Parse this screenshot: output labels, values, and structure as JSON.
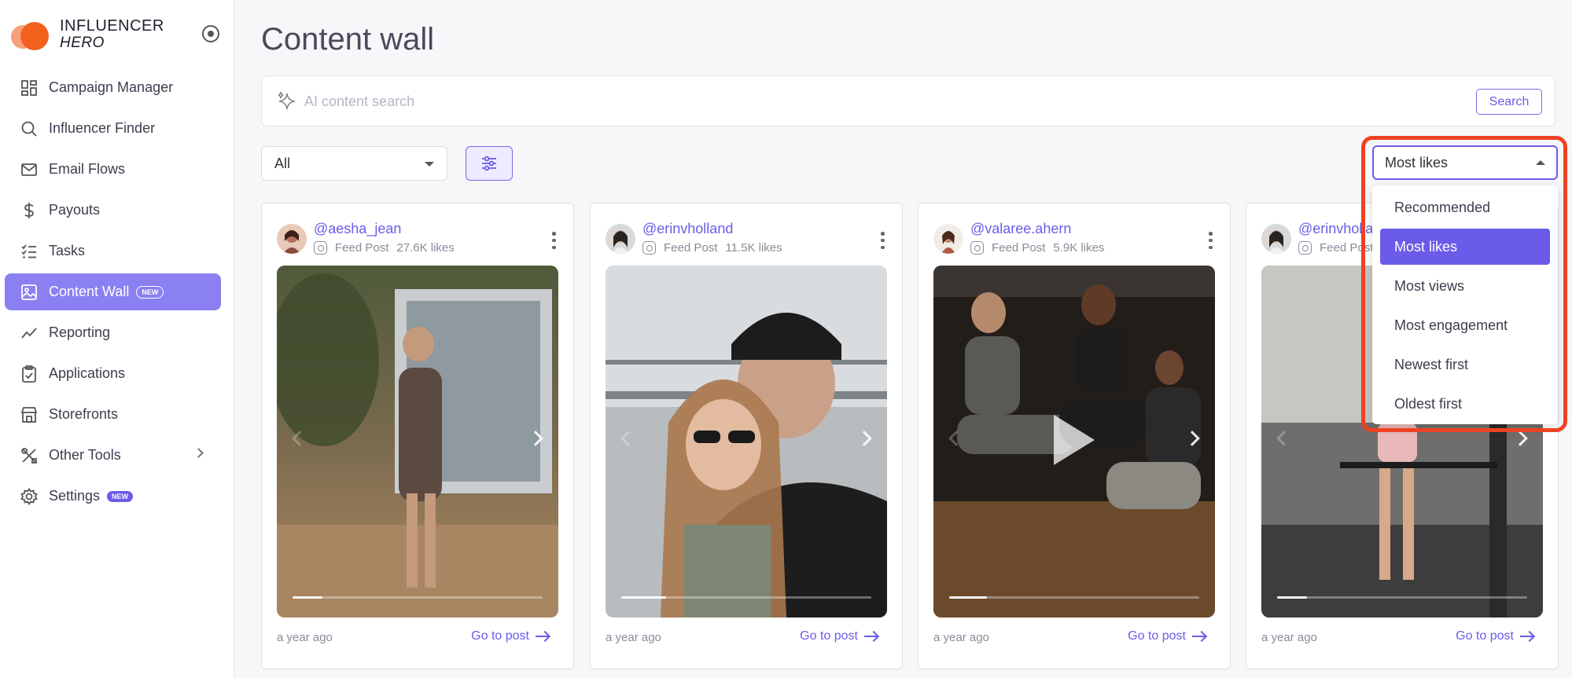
{
  "brand": {
    "line1": "INFLUENCER",
    "line2": "HERO"
  },
  "sidebar": {
    "items": [
      {
        "label": "Campaign Manager"
      },
      {
        "label": "Influencer Finder"
      },
      {
        "label": "Email Flows"
      },
      {
        "label": "Payouts"
      },
      {
        "label": "Tasks"
      },
      {
        "label": "Content Wall",
        "badge": "NEW",
        "active": true
      },
      {
        "label": "Reporting"
      },
      {
        "label": "Applications"
      },
      {
        "label": "Storefronts"
      },
      {
        "label": "Other Tools"
      },
      {
        "label": "Settings",
        "badge": "NEW"
      }
    ]
  },
  "main": {
    "title": "Content wall",
    "search": {
      "placeholder": "AI content search",
      "button": "Search"
    },
    "filter": {
      "value": "All"
    },
    "sort": {
      "value": "Most likes",
      "options": [
        "Recommended",
        "Most likes",
        "Most views",
        "Most engagement",
        "Newest first",
        "Oldest first"
      ],
      "selected_index": 1
    },
    "cards": [
      {
        "handle": "@aesha_jean",
        "type": "Feed Post",
        "likes": "27.6K likes",
        "time": "a year ago",
        "link": "Go to post"
      },
      {
        "handle": "@erinvholland",
        "type": "Feed Post",
        "likes": "11.5K likes",
        "time": "a year ago",
        "link": "Go to post"
      },
      {
        "handle": "@valaree.ahern",
        "type": "Feed Post",
        "likes": "5.9K likes",
        "time": "a year ago",
        "link": "Go to post"
      },
      {
        "handle": "@erinvholland",
        "type": "Feed Post",
        "likes": "",
        "time": "a year ago",
        "link": "Go to post"
      }
    ]
  },
  "colors": {
    "accent": "#6a5ce8",
    "active_nav": "#8a80f2",
    "highlight": "#ef4123",
    "brand_orange": "#f2621d"
  }
}
